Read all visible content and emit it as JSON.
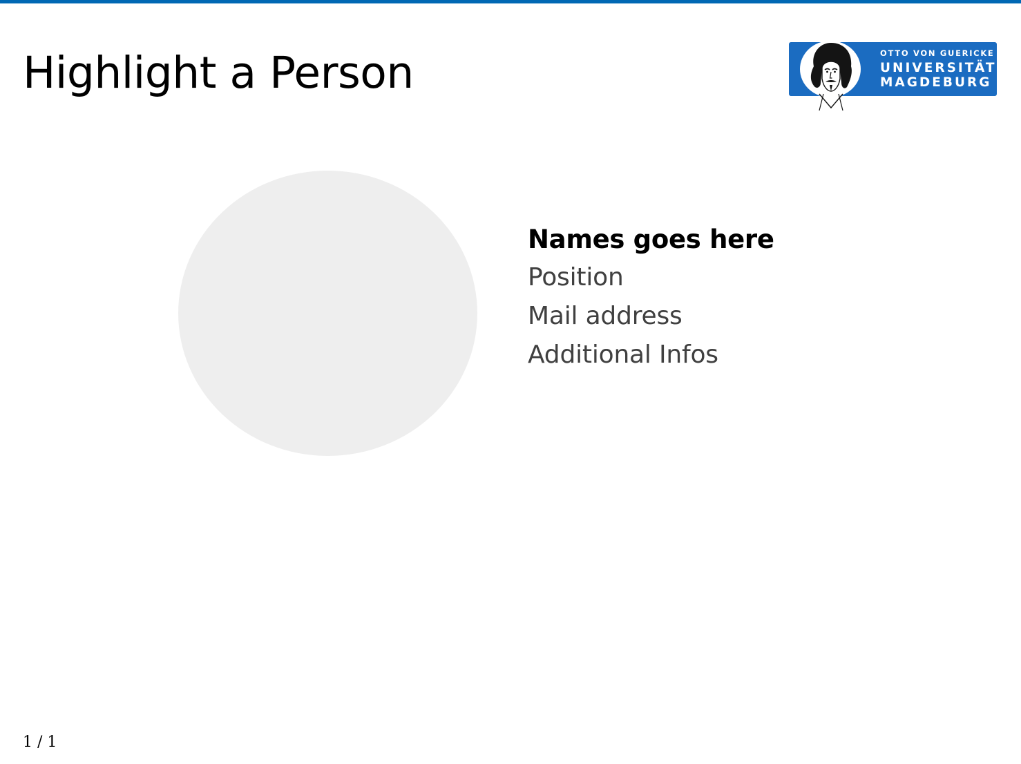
{
  "slide": {
    "title": "Highlight a Person",
    "page_number": "1 / 1"
  },
  "logo": {
    "line1": "OTTO VON GUERICKE",
    "line2": "UNIVERSITÄT",
    "line3": "MAGDEBURG",
    "icon": "guericke-portrait-icon"
  },
  "person": {
    "name": "Names goes here",
    "position": "Position",
    "mail": "Mail address",
    "additional": "Additional Infos"
  },
  "colors": {
    "accent": "#0068b4",
    "logo_blue": "#1b6cc1",
    "placeholder_gray": "#eeeeee",
    "info_text": "#404040"
  }
}
